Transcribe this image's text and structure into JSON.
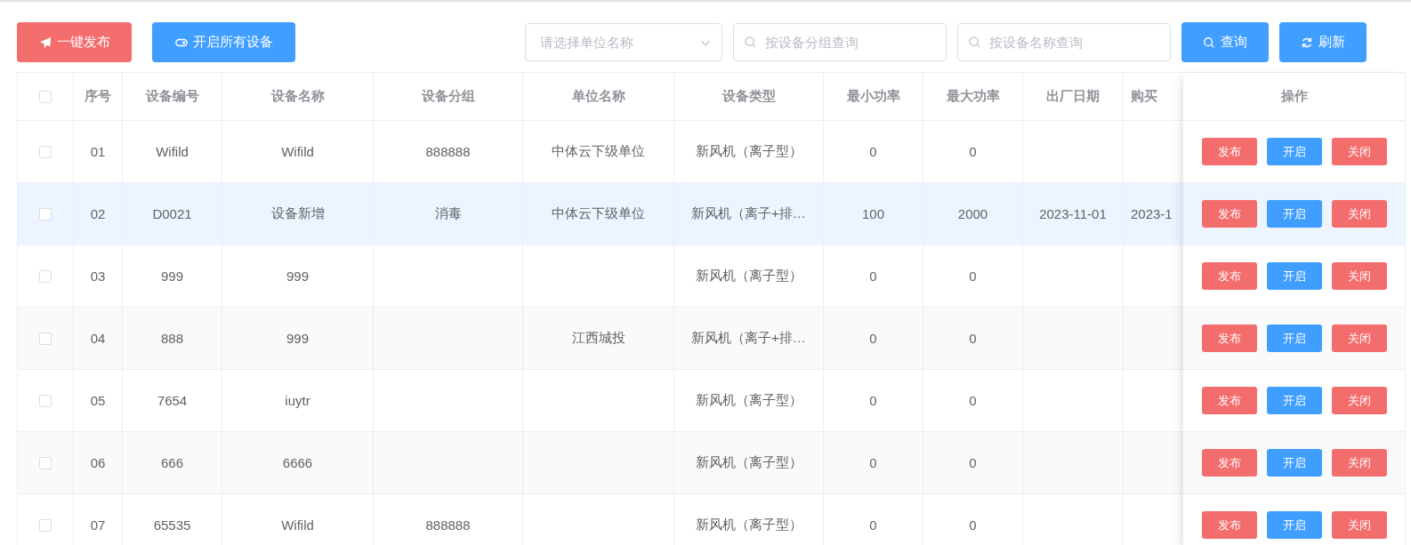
{
  "toolbar": {
    "buttons": [
      {
        "label": "一键发布",
        "kind": "publish"
      },
      {
        "label": "开启所有设备",
        "kind": "enable"
      }
    ],
    "unit_select": {
      "placeholder": "请选择单位名称"
    },
    "group_search": {
      "placeholder": "按设备分组查询"
    },
    "name_search": {
      "placeholder": "按设备名称查询"
    },
    "actions": [
      {
        "label": "查询",
        "kind": "search"
      },
      {
        "label": "刷新",
        "kind": "refresh"
      }
    ]
  },
  "table": {
    "header_checked": false,
    "columns": [
      "序号",
      "设备编号",
      "设备名称",
      "设备分组",
      "单位名称",
      "设备类型",
      "最小功率",
      "最大功率",
      "出厂日期",
      "购买"
    ],
    "action_column": "操作",
    "rows": [
      {
        "checked": false,
        "selected": false,
        "cells": [
          "01",
          "Wifild",
          "Wifild",
          "888888",
          "中体云下级单位",
          "新风机（离子型）",
          "0",
          "0",
          null,
          null
        ],
        "actions": [
          {
            "label": "发布",
            "kind": "danger"
          },
          {
            "label": "开启",
            "kind": "primary"
          },
          {
            "label": "关闭",
            "kind": "danger"
          }
        ]
      },
      {
        "checked": false,
        "selected": true,
        "cells": [
          "02",
          "D0021",
          "设备新增",
          "消毒",
          "中体云下级单位",
          "新风机（离子+排…",
          "100",
          "2000",
          "2023-11-01",
          "2023-1"
        ],
        "actions": [
          {
            "label": "发布",
            "kind": "danger"
          },
          {
            "label": "开启",
            "kind": "primary"
          },
          {
            "label": "关闭",
            "kind": "danger"
          }
        ]
      },
      {
        "checked": false,
        "selected": false,
        "cells": [
          "03",
          "999",
          "999",
          null,
          null,
          "新风机（离子型）",
          "0",
          "0",
          null,
          null
        ],
        "actions": [
          {
            "label": "发布",
            "kind": "danger"
          },
          {
            "label": "开启",
            "kind": "primary"
          },
          {
            "label": "关闭",
            "kind": "danger"
          }
        ]
      },
      {
        "checked": false,
        "selected": false,
        "cells": [
          "04",
          "888",
          "999",
          null,
          "江西城投",
          "新风机（离子+排…",
          "0",
          "0",
          null,
          null
        ],
        "actions": [
          {
            "label": "发布",
            "kind": "danger"
          },
          {
            "label": "开启",
            "kind": "primary"
          },
          {
            "label": "关闭",
            "kind": "danger"
          }
        ]
      },
      {
        "checked": false,
        "selected": false,
        "cells": [
          "05",
          "7654",
          "iuytr",
          null,
          null,
          "新风机（离子型）",
          "0",
          "0",
          null,
          null
        ],
        "actions": [
          {
            "label": "发布",
            "kind": "danger"
          },
          {
            "label": "开启",
            "kind": "primary"
          },
          {
            "label": "关闭",
            "kind": "danger"
          }
        ]
      },
      {
        "checked": false,
        "selected": false,
        "cells": [
          "06",
          "666",
          "6666",
          null,
          null,
          "新风机（离子型）",
          "0",
          "0",
          null,
          null
        ],
        "actions": [
          {
            "label": "发布",
            "kind": "danger"
          },
          {
            "label": "开启",
            "kind": "primary"
          },
          {
            "label": "关闭",
            "kind": "danger"
          }
        ]
      },
      {
        "checked": false,
        "selected": false,
        "cells": [
          "07",
          "65535",
          "Wifild",
          "888888",
          null,
          "新风机（离子型）",
          "0",
          "0",
          null,
          null
        ],
        "actions": [
          {
            "label": "发布",
            "kind": "danger"
          },
          {
            "label": "开启",
            "kind": "primary"
          },
          {
            "label": "关闭",
            "kind": "danger"
          }
        ]
      }
    ]
  }
}
